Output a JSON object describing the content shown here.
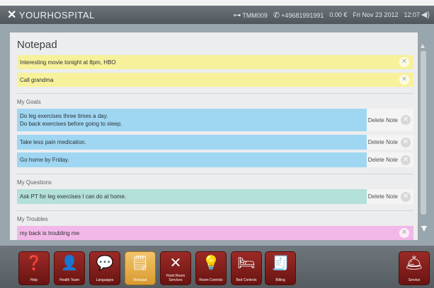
{
  "header": {
    "logo_text": "YOURHOSPITAL",
    "room": "TMM009",
    "phone": "+49681991991",
    "balance": "0.00 €",
    "date": "Fri Nov 23 2012",
    "time": "12:07"
  },
  "panel": {
    "title": "Notepad",
    "notes": [
      {
        "text": "Interesting movie tonight at 8pm, HBO"
      },
      {
        "text": "Call grandma"
      }
    ],
    "goals_heading": "My Goals",
    "goals": [
      {
        "line1": "Do leg exercises three times a day.",
        "line2": "Do back exercises before going to sleep."
      },
      {
        "line1": "Take less pain medication."
      },
      {
        "line1": "Go home by Friday."
      }
    ],
    "questions_heading": "My Questions",
    "questions": [
      {
        "text": "Ask PT for leg exercises I can do at home."
      }
    ],
    "troubles_heading": "My Troubles",
    "troubles": [
      {
        "text": "my back is troubling me"
      }
    ],
    "delete_label": "Delete Note"
  },
  "dock": {
    "buttons": [
      {
        "label": "Help"
      },
      {
        "label": "Health Team"
      },
      {
        "label": "Languages"
      },
      {
        "label": "Notepad"
      },
      {
        "label": "Hotel Room Services"
      },
      {
        "label": "Room Controls"
      },
      {
        "label": "Bed Controls"
      },
      {
        "label": "Billing"
      },
      {
        "label": "Service"
      }
    ]
  },
  "colors": {
    "yellow_note": "#f7f19c",
    "blue_note": "#9fd7f3",
    "teal_note": "#b3e0d8",
    "pink_note": "#f2b8e8",
    "dock_button": "#8a221e",
    "active_button": "#e9b24f"
  }
}
